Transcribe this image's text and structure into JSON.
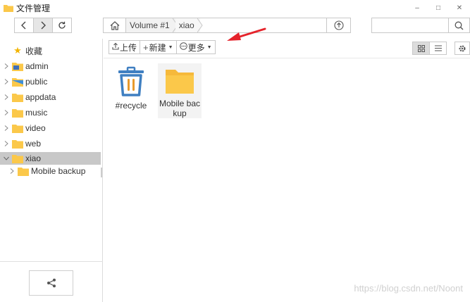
{
  "window": {
    "title": "文件管理",
    "minimize": "–",
    "maximize": "□",
    "close": "✕"
  },
  "path": {
    "crumbs": [
      "Volume #1",
      "xiao"
    ]
  },
  "search": {
    "placeholder": "",
    "value": ""
  },
  "sidebar": {
    "favorites_label": "收藏",
    "items": [
      {
        "label": "admin",
        "icon": "user-folder-icon"
      },
      {
        "label": "public",
        "icon": "shared-folder-icon"
      },
      {
        "label": "appdata",
        "icon": "folder-icon"
      },
      {
        "label": "music",
        "icon": "folder-icon"
      },
      {
        "label": "video",
        "icon": "folder-icon"
      },
      {
        "label": "web",
        "icon": "folder-icon"
      },
      {
        "label": "xiao",
        "icon": "folder-icon",
        "selected": true
      },
      {
        "label": "Mobile backup",
        "icon": "folder-icon",
        "child": true
      }
    ]
  },
  "toolbar": {
    "upload_label": "上传",
    "new_label": "新建",
    "more_label": "更多"
  },
  "files": [
    {
      "name": "#recycle",
      "icon": "recycle-bin-icon"
    },
    {
      "name": "Mobile backup",
      "icon": "folder-icon"
    }
  ],
  "watermark": "https://blog.csdn.net/Noont",
  "colors": {
    "folder": "#FBC84A",
    "recycle_blue": "#3F7FC1",
    "recycle_orange": "#E89A2C",
    "selected_row": "#C8C8C8",
    "annotation_arrow": "#E5232B"
  }
}
